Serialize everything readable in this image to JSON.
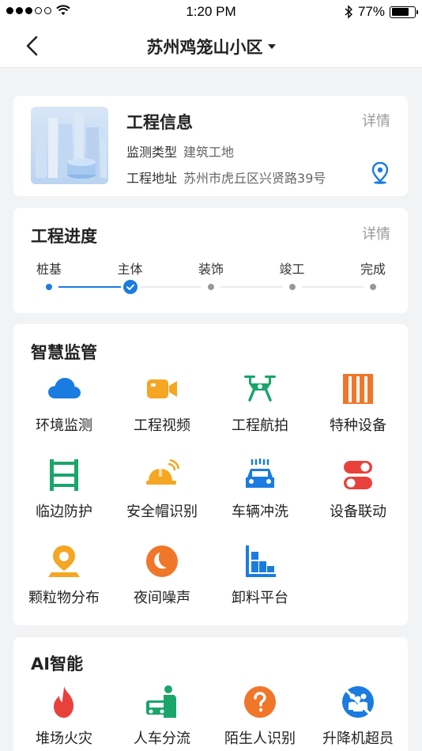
{
  "status": {
    "time": "1:20 PM",
    "battery": "77%",
    "battery_level": 0.77
  },
  "nav": {
    "title": "苏州鸡笼山小区"
  },
  "project": {
    "title": "工程信息",
    "detail": "详情",
    "type_label": "监测类型",
    "type_value": "建筑工地",
    "addr_label": "工程地址",
    "addr_value": "苏州市虎丘区兴贤路39号"
  },
  "progress": {
    "title": "工程进度",
    "detail": "详情",
    "steps": [
      {
        "label": "桩基",
        "state": "done"
      },
      {
        "label": "主体",
        "state": "current"
      },
      {
        "label": "装饰",
        "state": "todo"
      },
      {
        "label": "竣工",
        "state": "todo"
      },
      {
        "label": "完成",
        "state": "todo"
      }
    ]
  },
  "smart": {
    "title": "智慧监管",
    "items": [
      {
        "label": "环境监测",
        "icon": "cloud-icon",
        "color": "#1a7be0"
      },
      {
        "label": "工程视频",
        "icon": "video-camera-icon",
        "color": "#f5a623"
      },
      {
        "label": "工程航拍",
        "icon": "drone-icon",
        "color": "#1aa56b"
      },
      {
        "label": "特种设备",
        "icon": "equipment-cabinet-icon",
        "color": "#f0762a"
      },
      {
        "label": "临边防护",
        "icon": "guardrail-icon",
        "color": "#1aa56b"
      },
      {
        "label": "安全帽识别",
        "icon": "safety-helmet-icon",
        "color": "#f5a623"
      },
      {
        "label": "车辆冲洗",
        "icon": "car-wash-icon",
        "color": "#1a7be0"
      },
      {
        "label": "设备联动",
        "icon": "toggle-switch-icon",
        "color": "#e8413b"
      },
      {
        "label": "颗粒物分布",
        "icon": "location-pin-icon",
        "color": "#f5a623"
      },
      {
        "label": "夜间噪声",
        "icon": "moon-icon",
        "color": "#f0762a"
      },
      {
        "label": "卸料平台",
        "icon": "platform-chart-icon",
        "color": "#1a7be0"
      }
    ]
  },
  "ai": {
    "title": "AI智能",
    "items": [
      {
        "label": "堆场火灾",
        "icon": "fire-icon",
        "color": "#e8413b"
      },
      {
        "label": "人车分流",
        "icon": "person-car-icon",
        "color": "#1aa56b"
      },
      {
        "label": "陌生人识别",
        "icon": "question-icon",
        "color": "#f0762a"
      },
      {
        "label": "升降机超员",
        "icon": "no-crowd-icon",
        "color": "#1a7be0"
      }
    ]
  }
}
